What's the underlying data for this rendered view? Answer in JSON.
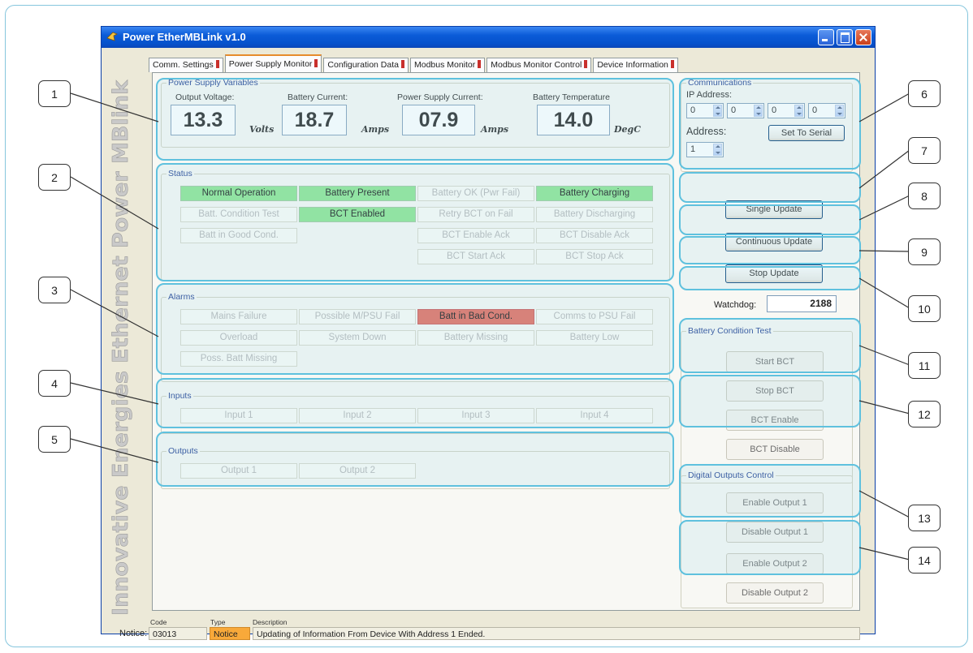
{
  "window": {
    "title": "Power EtherMBLink v1.0"
  },
  "brand_text": "Innovative Energies Ethernet Power MBlink",
  "tabs": [
    {
      "label": "Comm. Settings"
    },
    {
      "label": "Power Supply Monitor"
    },
    {
      "label": "Configuration Data"
    },
    {
      "label": "Modbus Monitor"
    },
    {
      "label": "Modbus Monitor Control"
    },
    {
      "label": "Device Information"
    }
  ],
  "ps_vars": {
    "title": "Power Supply Variables",
    "meters": [
      {
        "label": "Output Voltage:",
        "value": "13.3",
        "unit": "Volts"
      },
      {
        "label": "Battery Current:",
        "value": "18.7",
        "unit": "Amps"
      },
      {
        "label": "Power Supply Current:",
        "value": "07.9",
        "unit": "Amps"
      },
      {
        "label": "Battery Temperature",
        "value": "14.0",
        "unit": "DegC"
      }
    ]
  },
  "status": {
    "title": "Status",
    "items": [
      "Normal Operation",
      "Battery Present",
      "Battery OK (Pwr Fail)",
      "Battery Charging",
      "Batt. Condition Test",
      "BCT Enabled",
      "Retry BCT on Fail",
      "Battery Discharging",
      "Batt in Good Cond.",
      "BCT Enable Ack",
      "BCT Disable Ack",
      "BCT  Start Ack",
      "BCT Stop Ack"
    ]
  },
  "alarms": {
    "title": "Alarms",
    "items": [
      "Mains Failure",
      "Possible M/PSU Fail",
      "Batt in Bad Cond.",
      "Comms to PSU Fail",
      "Overload",
      "System Down",
      "Battery Missing",
      "Battery Low",
      "Poss. Batt Missing"
    ]
  },
  "inputs": {
    "title": "Inputs",
    "items": [
      "Input 1",
      "Input 2",
      "Input 3",
      "Input 4"
    ]
  },
  "outputs": {
    "title": "Outputs",
    "items": [
      "Output 1",
      "Output 2"
    ]
  },
  "comms": {
    "title": "Communications",
    "ip_label": "IP Address:",
    "ip": [
      "0",
      "0",
      "0",
      "0"
    ],
    "address_label": "Address:",
    "address": "1",
    "set_serial": "Set To Serial"
  },
  "update": {
    "single": "Single Update",
    "continuous": "Continuous Update",
    "stop": "Stop Update"
  },
  "watchdog": {
    "label": "Watchdog:",
    "value": "2188"
  },
  "bct": {
    "title": "Battery Condition Test",
    "start": "Start BCT",
    "stop": "Stop BCT",
    "enable": "BCT Enable",
    "disable": "BCT Disable"
  },
  "digital": {
    "title": "Digital Outputs Control",
    "en1": "Enable Output 1",
    "dis1": "Disable Output 1",
    "en2": "Enable Output 2",
    "dis2": "Disable Output 2"
  },
  "notice": {
    "label": "Notice:",
    "code_header": "Code",
    "type_header": "Type",
    "desc_header": "Description",
    "code": "03013",
    "type": "Notice",
    "description": "Updating of Information From Device With Address 1 Ended."
  },
  "callouts": [
    "1",
    "2",
    "3",
    "4",
    "5",
    "6",
    "7",
    "8",
    "9",
    "10",
    "11",
    "12",
    "13",
    "14"
  ],
  "colors": {
    "active_green": "#8ae48f",
    "alarm_red": "#e3685a",
    "highlight": "#5fc1de",
    "notice_orange": "#f8a93a"
  }
}
